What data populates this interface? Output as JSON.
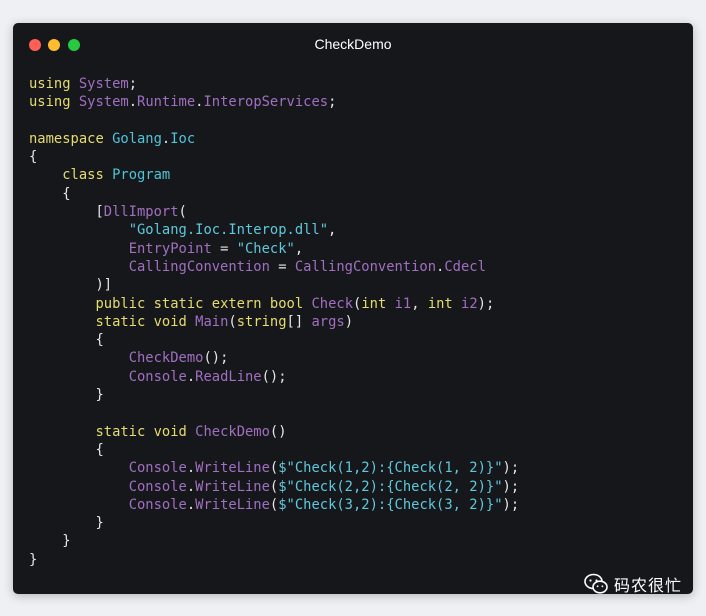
{
  "window": {
    "title": "CheckDemo",
    "background": "#16171b",
    "traffic_lights": [
      {
        "name": "close",
        "color": "#fe5f57"
      },
      {
        "name": "minimize",
        "color": "#febc2e"
      },
      {
        "name": "zoom",
        "color": "#28c840"
      }
    ]
  },
  "syntax_colors": {
    "keyword": "#e6dc6e",
    "type": "#4fc3d8",
    "identifier": "#a06fc0",
    "string": "#5ec8dc",
    "plain": "#e6e6e6"
  },
  "code_lines": [
    [
      [
        "kw",
        "using"
      ],
      [
        "pl",
        " "
      ],
      [
        "id",
        "System"
      ],
      [
        "pl",
        ";"
      ]
    ],
    [
      [
        "kw",
        "using"
      ],
      [
        "pl",
        " "
      ],
      [
        "id",
        "System"
      ],
      [
        "pl",
        "."
      ],
      [
        "id",
        "Runtime"
      ],
      [
        "pl",
        "."
      ],
      [
        "id",
        "InteropServices"
      ],
      [
        "pl",
        ";"
      ]
    ],
    [],
    [
      [
        "kw",
        "namespace"
      ],
      [
        "pl",
        " "
      ],
      [
        "ty",
        "Golang"
      ],
      [
        "pl",
        "."
      ],
      [
        "ty",
        "Ioc"
      ]
    ],
    [
      [
        "pl",
        "{"
      ]
    ],
    [
      [
        "pl",
        "    "
      ],
      [
        "kw",
        "class"
      ],
      [
        "pl",
        " "
      ],
      [
        "ty",
        "Program"
      ]
    ],
    [
      [
        "pl",
        "    {"
      ]
    ],
    [
      [
        "pl",
        "        ["
      ],
      [
        "id",
        "DllImport"
      ],
      [
        "pl",
        "("
      ]
    ],
    [
      [
        "pl",
        "            "
      ],
      [
        "st",
        "\"Golang.Ioc.Interop.dll\""
      ],
      [
        "pl",
        ","
      ]
    ],
    [
      [
        "pl",
        "            "
      ],
      [
        "id",
        "EntryPoint"
      ],
      [
        "pl",
        " = "
      ],
      [
        "st",
        "\"Check\""
      ],
      [
        "pl",
        ","
      ]
    ],
    [
      [
        "pl",
        "            "
      ],
      [
        "id",
        "CallingConvention"
      ],
      [
        "pl",
        " = "
      ],
      [
        "id",
        "CallingConvention"
      ],
      [
        "pl",
        "."
      ],
      [
        "id",
        "Cdecl"
      ]
    ],
    [
      [
        "pl",
        "        )]"
      ]
    ],
    [
      [
        "pl",
        "        "
      ],
      [
        "kw",
        "public"
      ],
      [
        "pl",
        " "
      ],
      [
        "kw",
        "static"
      ],
      [
        "pl",
        " "
      ],
      [
        "kw",
        "extern"
      ],
      [
        "pl",
        " "
      ],
      [
        "kw",
        "bool"
      ],
      [
        "pl",
        " "
      ],
      [
        "id",
        "Check"
      ],
      [
        "pl",
        "("
      ],
      [
        "kw",
        "int"
      ],
      [
        "pl",
        " "
      ],
      [
        "id",
        "i1"
      ],
      [
        "pl",
        ", "
      ],
      [
        "kw",
        "int"
      ],
      [
        "pl",
        " "
      ],
      [
        "id",
        "i2"
      ],
      [
        "pl",
        ");"
      ]
    ],
    [
      [
        "pl",
        "        "
      ],
      [
        "kw",
        "static"
      ],
      [
        "pl",
        " "
      ],
      [
        "kw",
        "void"
      ],
      [
        "pl",
        " "
      ],
      [
        "id",
        "Main"
      ],
      [
        "pl",
        "("
      ],
      [
        "kw",
        "string"
      ],
      [
        "pl",
        "[] "
      ],
      [
        "id",
        "args"
      ],
      [
        "pl",
        ")"
      ]
    ],
    [
      [
        "pl",
        "        {"
      ]
    ],
    [
      [
        "pl",
        "            "
      ],
      [
        "id",
        "CheckDemo"
      ],
      [
        "pl",
        "();"
      ]
    ],
    [
      [
        "pl",
        "            "
      ],
      [
        "id",
        "Console"
      ],
      [
        "pl",
        "."
      ],
      [
        "id",
        "ReadLine"
      ],
      [
        "pl",
        "();"
      ]
    ],
    [
      [
        "pl",
        "        }"
      ]
    ],
    [],
    [
      [
        "pl",
        "        "
      ],
      [
        "kw",
        "static"
      ],
      [
        "pl",
        " "
      ],
      [
        "kw",
        "void"
      ],
      [
        "pl",
        " "
      ],
      [
        "id",
        "CheckDemo"
      ],
      [
        "pl",
        "()"
      ]
    ],
    [
      [
        "pl",
        "        {"
      ]
    ],
    [
      [
        "pl",
        "            "
      ],
      [
        "id",
        "Console"
      ],
      [
        "pl",
        "."
      ],
      [
        "id",
        "WriteLine"
      ],
      [
        "pl",
        "("
      ],
      [
        "st",
        "$\"Check(1,2):{Check(1, 2)}\""
      ],
      [
        "pl",
        ");"
      ]
    ],
    [
      [
        "pl",
        "            "
      ],
      [
        "id",
        "Console"
      ],
      [
        "pl",
        "."
      ],
      [
        "id",
        "WriteLine"
      ],
      [
        "pl",
        "("
      ],
      [
        "st",
        "$\"Check(2,2):{Check(2, 2)}\""
      ],
      [
        "pl",
        ");"
      ]
    ],
    [
      [
        "pl",
        "            "
      ],
      [
        "id",
        "Console"
      ],
      [
        "pl",
        "."
      ],
      [
        "id",
        "WriteLine"
      ],
      [
        "pl",
        "("
      ],
      [
        "st",
        "$\"Check(3,2):{Check(3, 2)}\""
      ],
      [
        "pl",
        ");"
      ]
    ],
    [
      [
        "pl",
        "        }"
      ]
    ],
    [
      [
        "pl",
        "    }"
      ]
    ],
    [
      [
        "pl",
        "}"
      ]
    ]
  ],
  "watermark": {
    "icon": "wechat-icon",
    "text": "码农很忙"
  }
}
